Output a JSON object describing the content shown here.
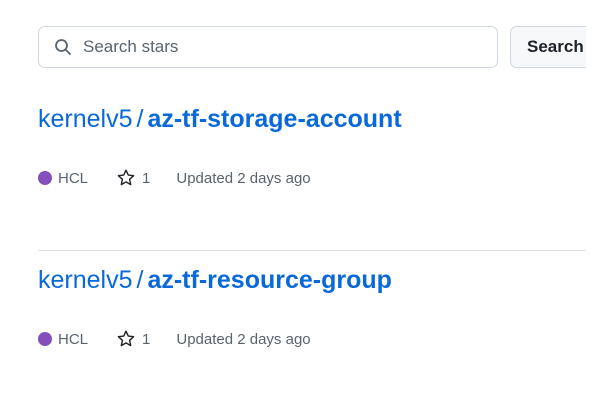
{
  "search": {
    "placeholder": "Search stars",
    "value": "",
    "button_label": "Search"
  },
  "repos": [
    {
      "owner": "kernelv5",
      "separator": "/",
      "name": "az-tf-storage-account",
      "language": "HCL",
      "language_color": "#844fba",
      "stars": "1",
      "updated": "Updated 2 days ago"
    },
    {
      "owner": "kernelv5",
      "separator": "/",
      "name": "az-tf-resource-group",
      "language": "HCL",
      "language_color": "#844fba",
      "stars": "1",
      "updated": "Updated 2 days ago"
    }
  ],
  "colors": {
    "link": "#0969da",
    "muted_text": "#59636e",
    "border": "#d0d7de"
  },
  "icons": {
    "search": "search-icon",
    "star": "star-icon"
  }
}
